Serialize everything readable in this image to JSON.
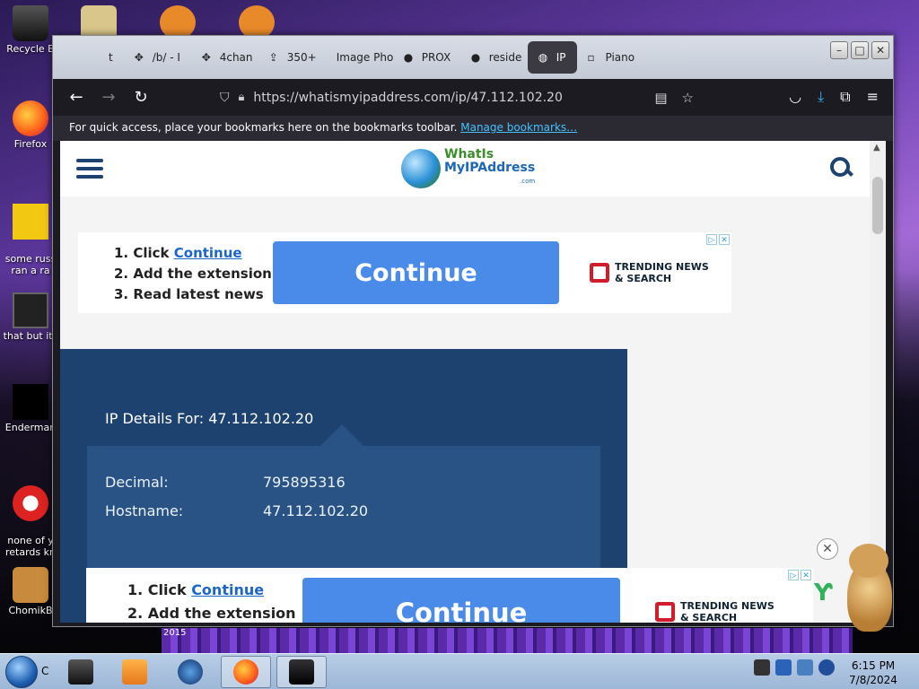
{
  "desktop": {
    "icons": [
      {
        "label": "Recycle B"
      },
      {
        "label": "Firefox"
      },
      {
        "label": "some russ\nran a ra"
      },
      {
        "label": "that but its"
      },
      {
        "label": "Enderman"
      },
      {
        "label": "none of y\nretards kn"
      },
      {
        "label": "ChomikB"
      }
    ]
  },
  "browser": {
    "tabs": [
      {
        "label": "t"
      },
      {
        "label": "/b/ - I"
      },
      {
        "label": "4chan"
      },
      {
        "label": "350+"
      },
      {
        "label": "Image Pho"
      },
      {
        "label": "PROX"
      },
      {
        "label": "reside"
      },
      {
        "label": "IP"
      },
      {
        "label": "Piano"
      }
    ],
    "url": "https://whatismyipaddress.com/ip/47.112.102.20",
    "bookmarks_text": "For quick access, place your bookmarks here on the bookmarks toolbar.",
    "bookmarks_link": "Manage bookmarks…"
  },
  "page": {
    "logo_line1": "WhatIs",
    "logo_line2": "MyIPAddress",
    "logo_line3": ".com",
    "ad": {
      "step1_prefix": "1. Click ",
      "step1_link": "Continue",
      "step2": "2. Add the extension",
      "step3": "3. Read latest news",
      "button": "Continue",
      "brand_line1": "TRENDING NEWS",
      "brand_line2": "& SEARCH"
    },
    "ip_card": {
      "title": "IP Details For: 47.112.102.20",
      "rows": [
        {
          "label": "Decimal:",
          "value": "795895316"
        },
        {
          "label": "Hostname:",
          "value": "47.112.102.20"
        }
      ]
    }
  },
  "taskbar": {
    "start_label": "C",
    "year": "2015",
    "clock_time": "6:15 PM",
    "clock_date": "7/8/2024"
  }
}
